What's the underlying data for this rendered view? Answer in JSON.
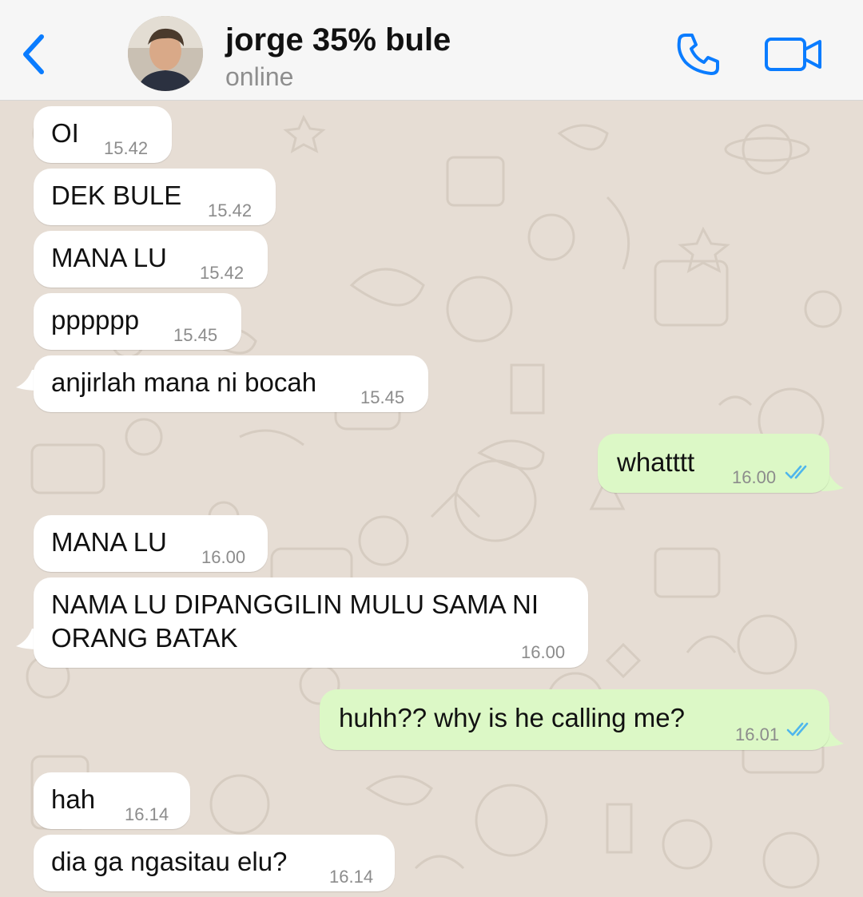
{
  "header": {
    "contact_name": "jorge 35% bule",
    "status": "online"
  },
  "colors": {
    "accent": "#0a7cff",
    "incoming_bubble": "#ffffff",
    "outgoing_bubble": "#dcf8c6",
    "read_ticks": "#4fb6ec",
    "wallpaper": "#e6ddd4"
  },
  "icons": {
    "back": "chevron-left-icon",
    "call": "phone-icon",
    "video": "video-camera-icon",
    "read_receipt": "double-check-icon"
  },
  "messages": [
    {
      "dir": "in",
      "text": "OI",
      "time": "15.42"
    },
    {
      "dir": "in",
      "text": "DEK BULE",
      "time": "15.42"
    },
    {
      "dir": "in",
      "text": "MANA LU",
      "time": "15.42"
    },
    {
      "dir": "in",
      "text": "pppppp",
      "time": "15.45"
    },
    {
      "dir": "in",
      "text": "anjirlah mana ni bocah",
      "time": "15.45"
    },
    {
      "dir": "out",
      "text": "whatttt",
      "time": "16.00",
      "read": true
    },
    {
      "dir": "in",
      "text": "MANA LU",
      "time": "16.00"
    },
    {
      "dir": "in",
      "text_line1": "NAMA LU DIPANGGILIN MULU SAMA NI",
      "text_line2": "ORANG BATAK",
      "time": "16.00"
    },
    {
      "dir": "out",
      "text": "huhh?? why is he calling me?",
      "time": "16.01",
      "read": true
    },
    {
      "dir": "in",
      "text": "hah",
      "time": "16.14"
    },
    {
      "dir": "in",
      "text": "dia ga ngasitau elu?",
      "time": "16.14"
    }
  ]
}
